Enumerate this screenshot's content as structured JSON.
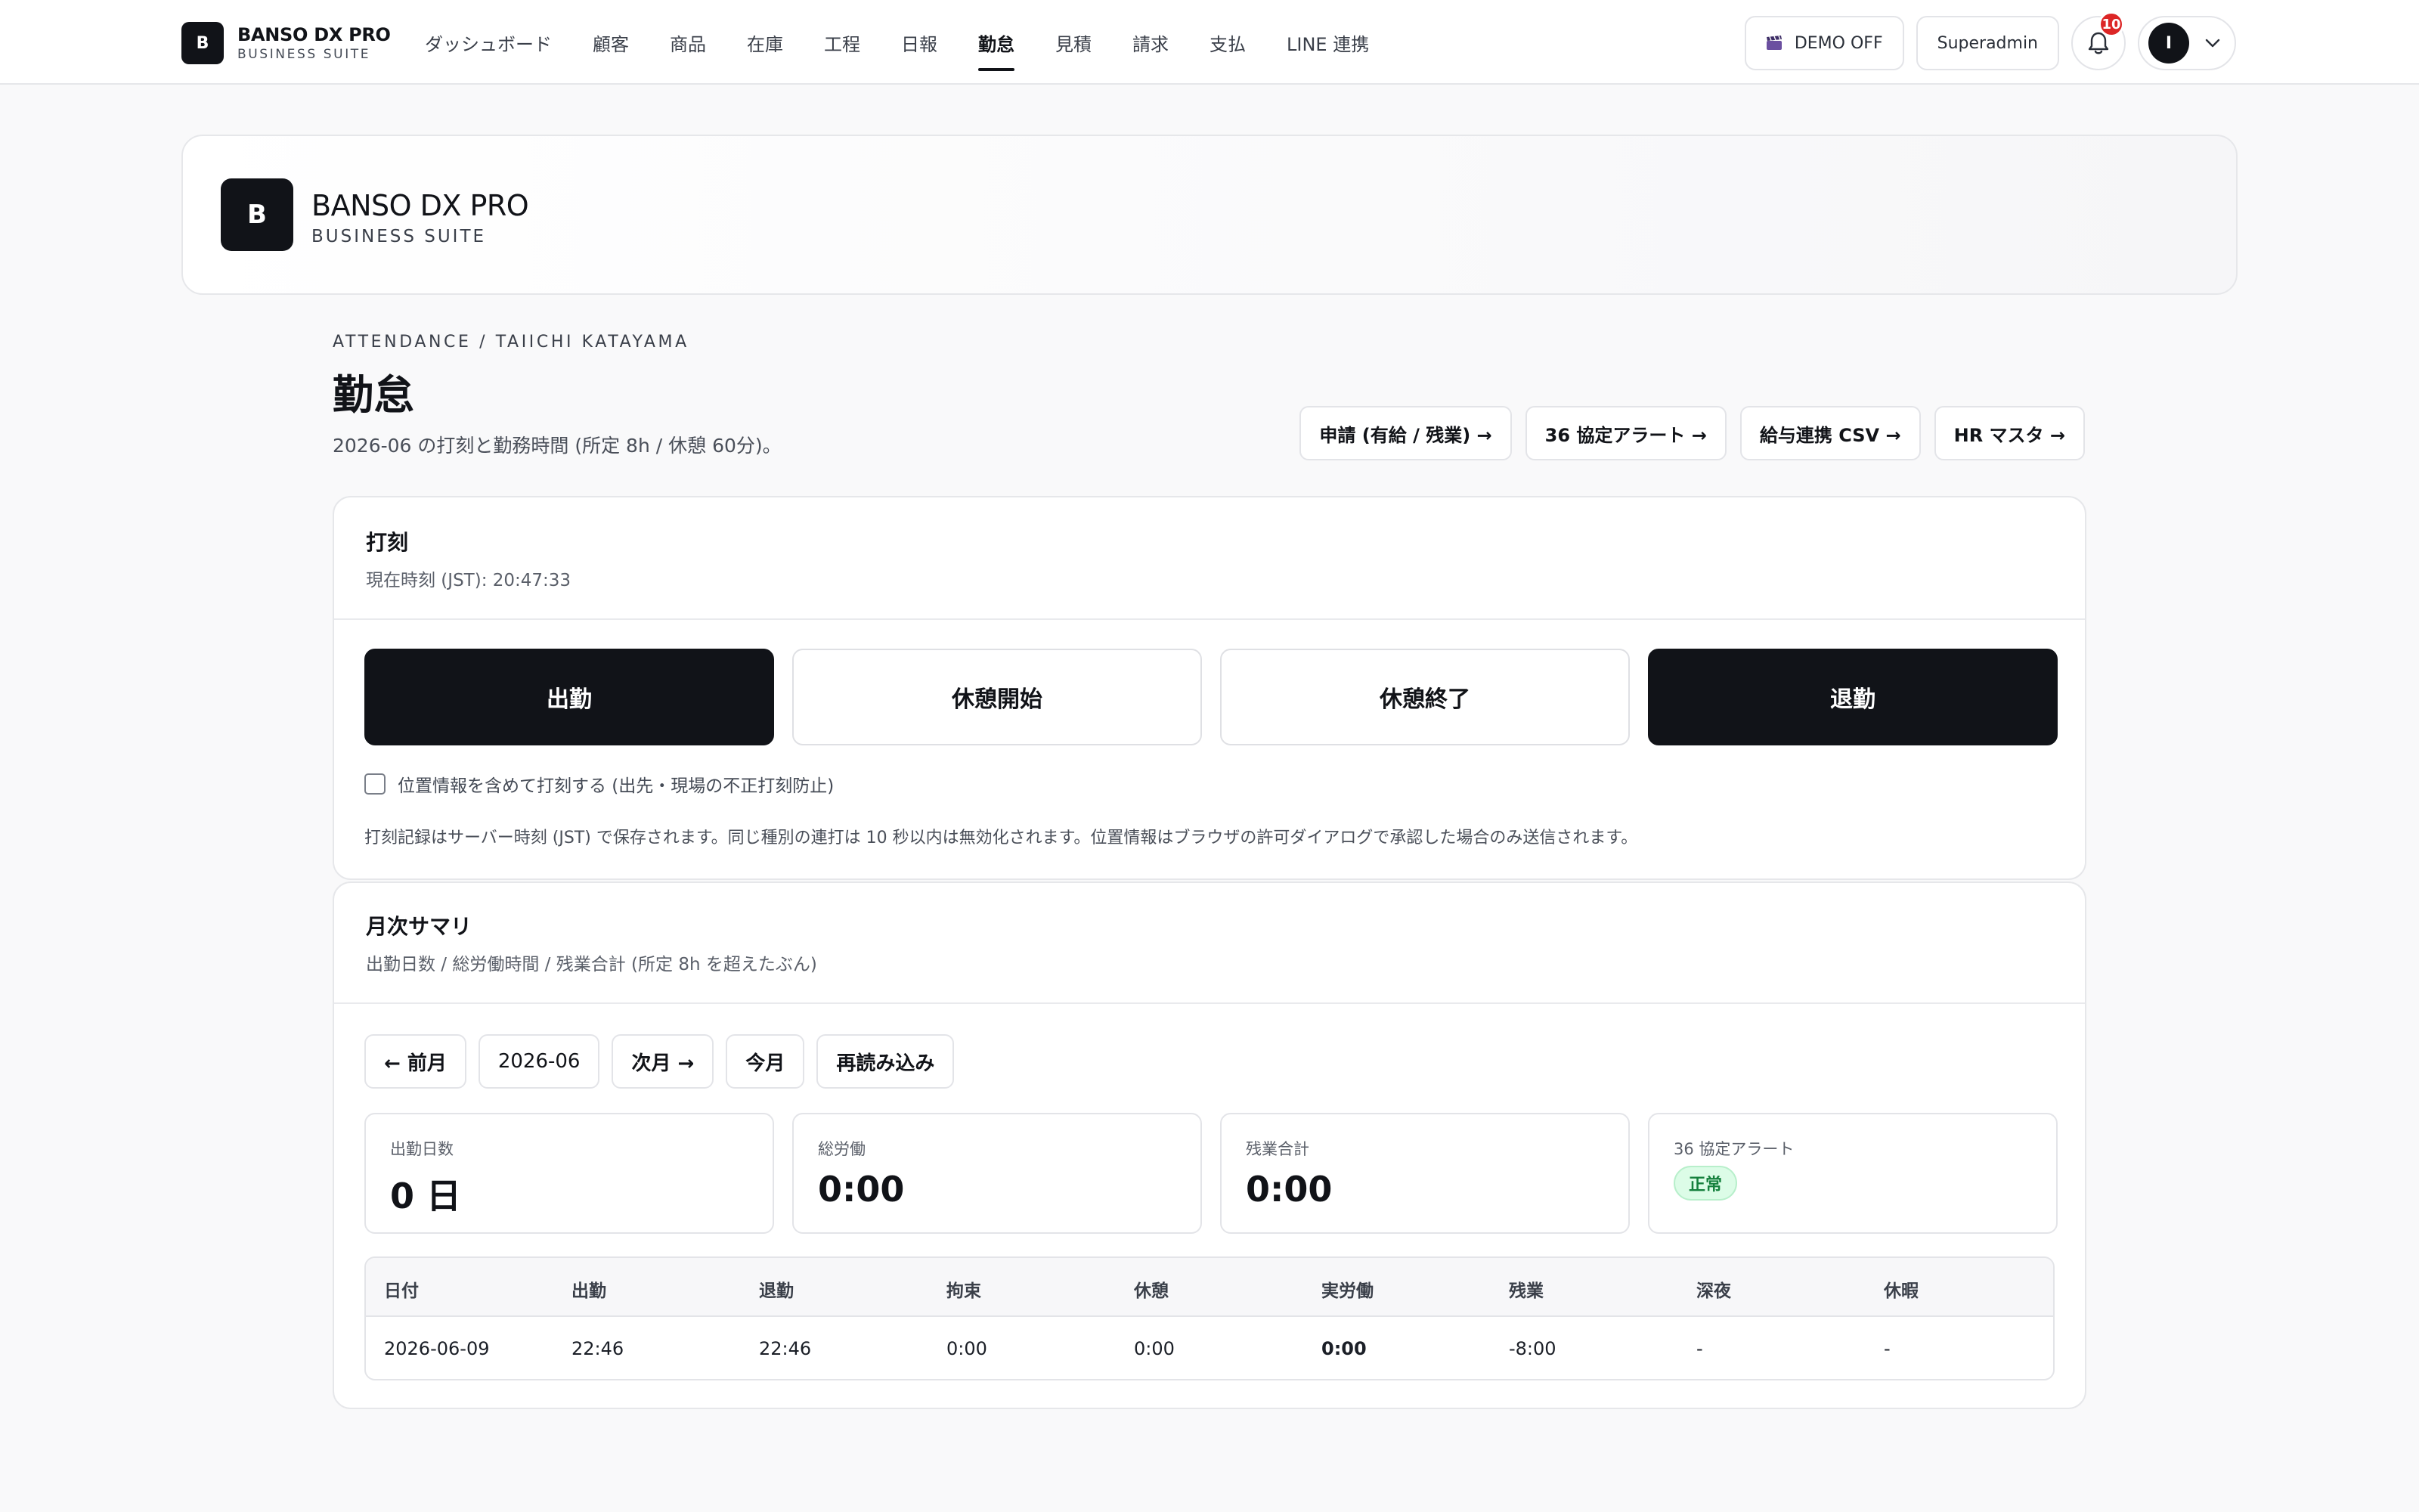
{
  "topnav": {
    "logo_letter": "B",
    "brand_name": "BANSO DX PRO",
    "brand_sub": "BUSINESS SUITE",
    "menu": [
      "ダッシュボード",
      "顧客",
      "商品",
      "在庫",
      "工程",
      "日報",
      "勤怠",
      "見積",
      "請求",
      "支払",
      "LINE 連携"
    ],
    "active_menu": "勤怠",
    "demo_label": "DEMO OFF",
    "demo_icon": "clapperboard-icon",
    "role_label": "Superadmin",
    "notification_count": "10",
    "avatar_letter": "I"
  },
  "banner": {
    "logo_letter": "B",
    "name": "BANSO DX PRO",
    "sub": "BUSINESS SUITE"
  },
  "page": {
    "breadcrumb": "ATTENDANCE / TAIICHI KATAYAMA",
    "title": "勤怠",
    "description": "2026-06 の打刻と勤務時間 (所定 8h / 休憩 60分)。",
    "actions": [
      "申請 (有給 / 残業) →",
      "36 協定アラート →",
      "給与連携 CSV →",
      "HR マスタ →"
    ]
  },
  "punch": {
    "title": "打刻",
    "current_time": "現在時刻 (JST): 20:47:33",
    "buttons": [
      "出勤",
      "休憩開始",
      "休憩終了",
      "退勤"
    ],
    "geo_label": "位置情報を含めて打刻する (出先・現場の不正打刻防止)",
    "geo_checked": false,
    "note": "打刻記録はサーバー時刻 (JST) で保存されます。同じ種別の連打は 10 秒以内は無効化されます。位置情報はブラウザの許可ダイアログで承認した場合のみ送信されます。"
  },
  "summary": {
    "title": "月次サマリ",
    "subtitle": "出勤日数 / 総労働時間 / 残業合計 (所定 8h を超えたぶん)",
    "prev_label": "← 前月",
    "month": "2026-06",
    "next_label": "次月 →",
    "this_month_label": "今月",
    "reload_label": "再読み込み",
    "stats": {
      "days_label": "出勤日数",
      "days_value": "0 日",
      "total_label": "総労働",
      "total_value": "0:00",
      "overtime_label": "残業合計",
      "overtime_value": "0:00",
      "alert_label": "36 協定アラート",
      "alert_value": "正常",
      "alert_color": "#15803d"
    },
    "table": {
      "headers": [
        "日付",
        "出勤",
        "退勤",
        "拘束",
        "休憩",
        "実労働",
        "残業",
        "深夜",
        "休暇"
      ],
      "rows": [
        [
          "2026-06-09",
          "22:46",
          "22:46",
          "0:00",
          "0:00",
          "0:00",
          "-8:00",
          "-",
          "-"
        ]
      ]
    }
  }
}
